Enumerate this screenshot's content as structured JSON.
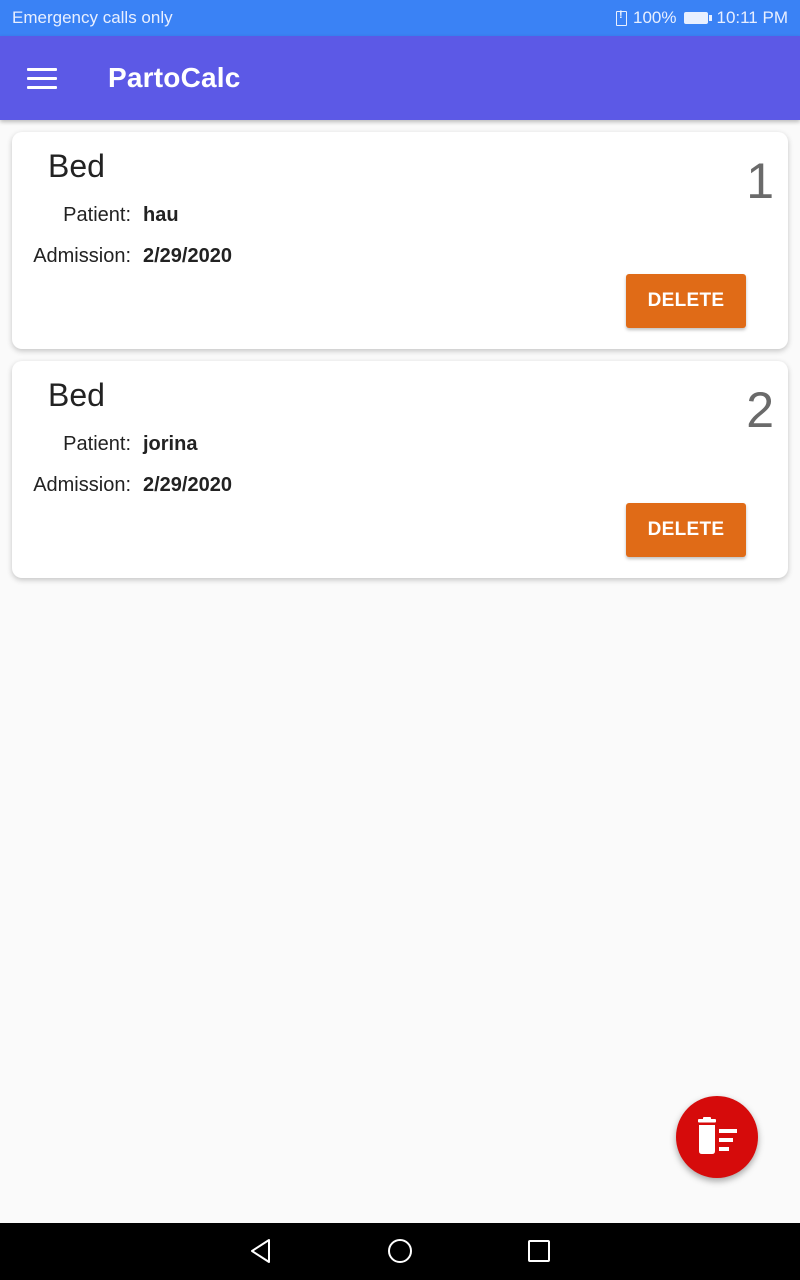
{
  "status_bar": {
    "carrier": "Emergency calls only",
    "battery": "100%",
    "time": "10:11 PM"
  },
  "app_bar": {
    "title": "PartoCalc",
    "menu_icon": "menu-icon"
  },
  "beds": [
    {
      "title": "Bed",
      "number": "1",
      "patient_label": "Patient:",
      "patient": "hau",
      "admission_label": "Admission:",
      "admission": "2/29/2020",
      "delete_label": "DELETE"
    },
    {
      "title": "Bed",
      "number": "2",
      "patient_label": "Patient:",
      "patient": "jorina",
      "admission_label": "Admission:",
      "admission": "2/29/2020",
      "delete_label": "DELETE"
    }
  ],
  "fab": {
    "icon": "delete-sweep-icon"
  },
  "navigation": {
    "back_icon": "back-triangle-icon",
    "home_icon": "home-circle-icon",
    "recents_icon": "recents-square-icon"
  },
  "colors": {
    "status_bar": "#3a82f5",
    "app_bar": "#5c59e6",
    "delete_button": "#e06b17",
    "fab": "#d60b0b"
  }
}
